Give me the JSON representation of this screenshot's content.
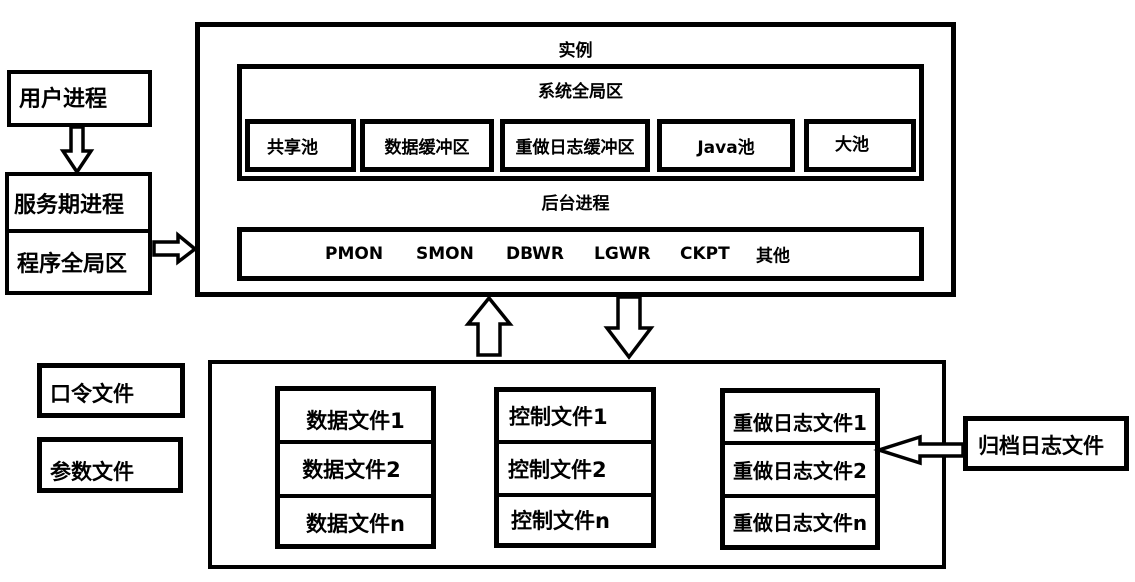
{
  "left": {
    "user_process": "用户进程",
    "server_process": "服务期进程",
    "pga": "程序全局区",
    "password_file": "口令文件",
    "parameter_file": "参数文件"
  },
  "instance": {
    "title": "实例",
    "sga": {
      "title": "系统全局区",
      "pools": [
        "共享池",
        "数据缓冲区",
        "重做日志缓冲区",
        "Java池",
        "大池"
      ]
    },
    "background": {
      "title": "后台进程",
      "processes": [
        "PMON",
        "SMON",
        "DBWR",
        "LGWR",
        "CKPT",
        "其他"
      ]
    }
  },
  "database": {
    "data_files": [
      "数据文件1",
      "数据文件2",
      "数据文件n"
    ],
    "control_files": [
      "控制文件1",
      "控制文件2",
      "控制文件n"
    ],
    "redo_files": [
      "重做日志文件1",
      "重做日志文件2",
      "重做日志文件n"
    ]
  },
  "archive": {
    "label": "归档日志文件"
  }
}
